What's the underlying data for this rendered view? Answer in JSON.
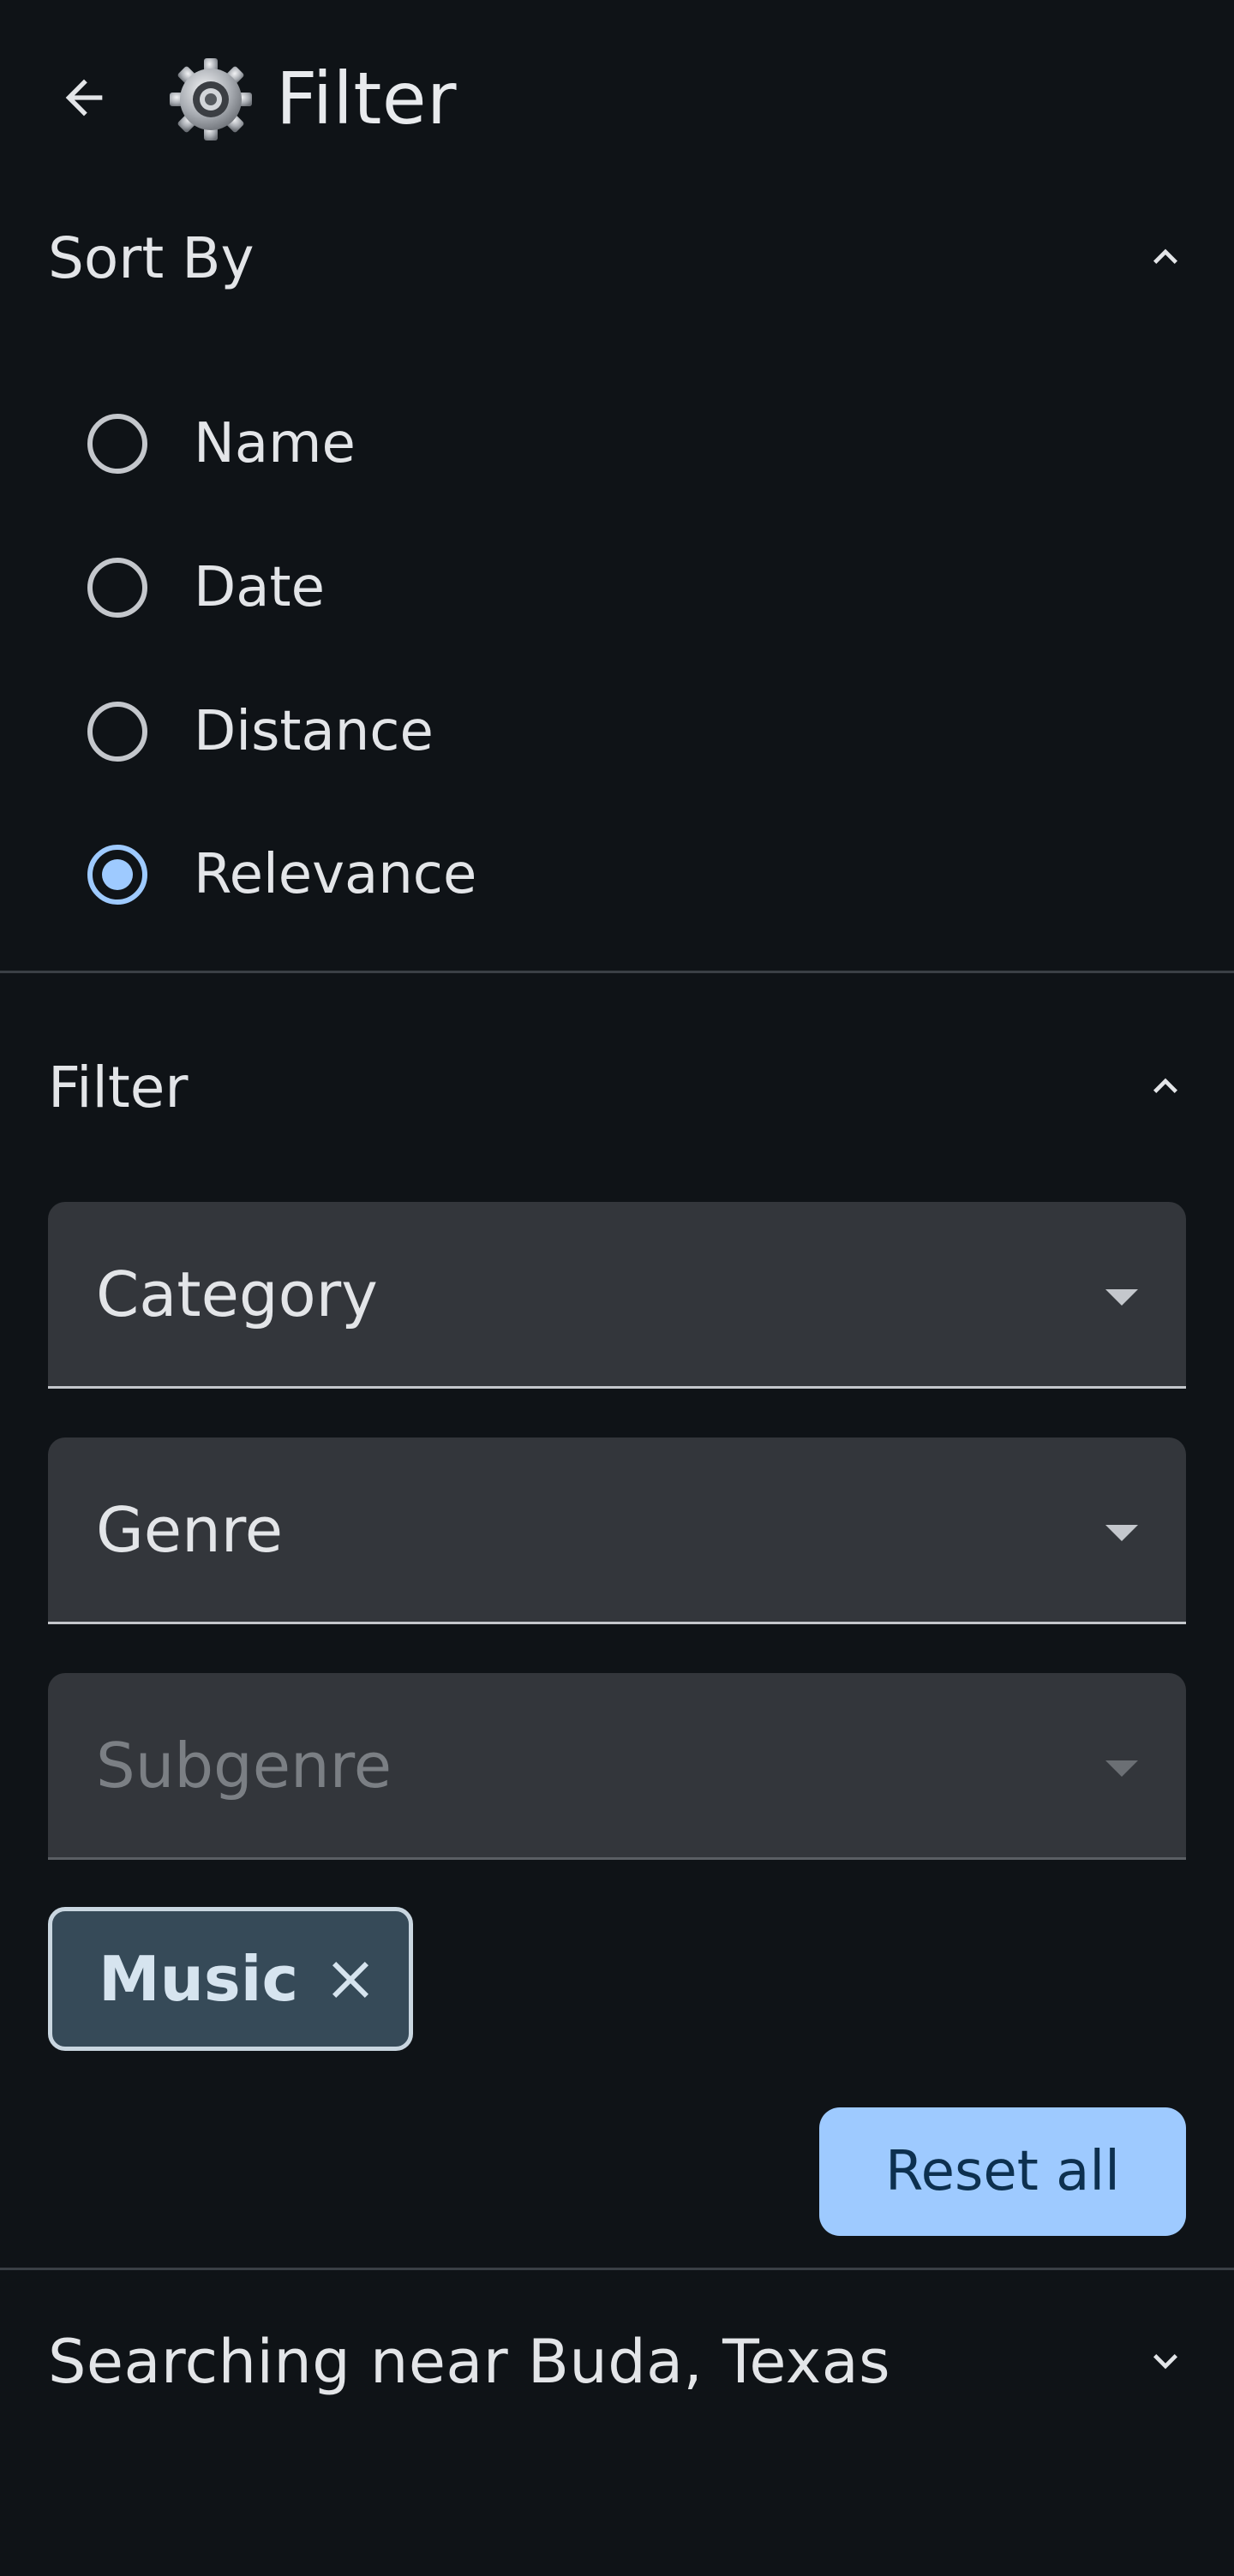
{
  "header": {
    "title": "Filter",
    "back_icon": "arrow-back-icon",
    "title_icon": "gear-icon"
  },
  "sort_by": {
    "title": "Sort By",
    "expanded": true,
    "options": [
      {
        "label": "Name",
        "checked": false
      },
      {
        "label": "Date",
        "checked": false
      },
      {
        "label": "Distance",
        "checked": false
      },
      {
        "label": "Relevance",
        "checked": true
      }
    ]
  },
  "filter": {
    "title": "Filter",
    "expanded": true,
    "dropdowns": [
      {
        "label": "Category",
        "enabled": true
      },
      {
        "label": "Genre",
        "enabled": true
      },
      {
        "label": "Subgenre",
        "enabled": false
      }
    ],
    "chips": [
      {
        "label": "Music"
      }
    ],
    "reset_label": "Reset all"
  },
  "location": {
    "title": "Searching near Buda, Texas",
    "expanded": false
  },
  "colors": {
    "background": "#0f1317",
    "accent": "#9ecaff",
    "surface": "#33363b",
    "chip_bg": "#364a58",
    "divider": "#3a3f45"
  }
}
